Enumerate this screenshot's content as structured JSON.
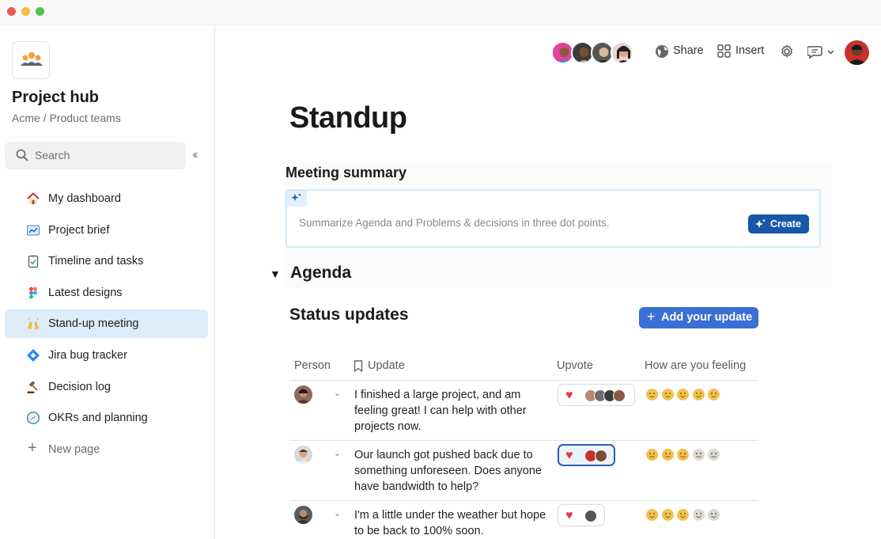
{
  "sidebar": {
    "title": "Project hub",
    "subtitle": "Acme / Product teams",
    "search_placeholder": "Search",
    "items": [
      {
        "label": "My dashboard",
        "icon": "house-icon"
      },
      {
        "label": "Project brief",
        "icon": "chart-icon"
      },
      {
        "label": "Timeline and tasks",
        "icon": "clipboard-check-icon"
      },
      {
        "label": "Latest designs",
        "icon": "figma-icon"
      },
      {
        "label": "Stand-up meeting",
        "icon": "raised-hands-icon",
        "active": true
      },
      {
        "label": "Jira bug tracker",
        "icon": "jira-icon"
      },
      {
        "label": "Decision log",
        "icon": "gavel-icon"
      },
      {
        "label": "OKRs and planning",
        "icon": "compass-icon"
      }
    ],
    "new_page": "New page"
  },
  "toolbar": {
    "share": "Share",
    "insert": "Insert"
  },
  "page": {
    "title": "Standup",
    "meeting_summary": "Meeting summary",
    "ai_prompt": "Summarize Agenda and Problems & decisions in three dot points.",
    "create": "Create",
    "agenda": "Agenda",
    "status_updates": "Status updates",
    "add_update": "Add your update"
  },
  "table": {
    "headers": {
      "person": "Person",
      "update": "Update",
      "upvote": "Upvote",
      "feeling": "How are you feeling"
    },
    "rows": [
      {
        "update": "I finished a large project, and am feeling great! I can help with other projects now.",
        "upvote_count": 4,
        "upvote_selected": false,
        "feeling_level": 5
      },
      {
        "update": "Our launch got pushed back due to something unforeseen. Does anyone have bandwidth to help?",
        "upvote_count": 2,
        "upvote_selected": true,
        "feeling_level": 3
      },
      {
        "update": "I'm a little under the weather but hope to be back to 100% soon.",
        "upvote_count": 1,
        "upvote_selected": false,
        "feeling_level": 3
      }
    ]
  },
  "colors": {
    "accent": "#3a6fd3",
    "create_button": "#1a56a8",
    "active_nav": "#dcecf8",
    "heart": "#e0393e",
    "emoji_on": "#f2c14e",
    "emoji_off": "#d9d9d9"
  }
}
